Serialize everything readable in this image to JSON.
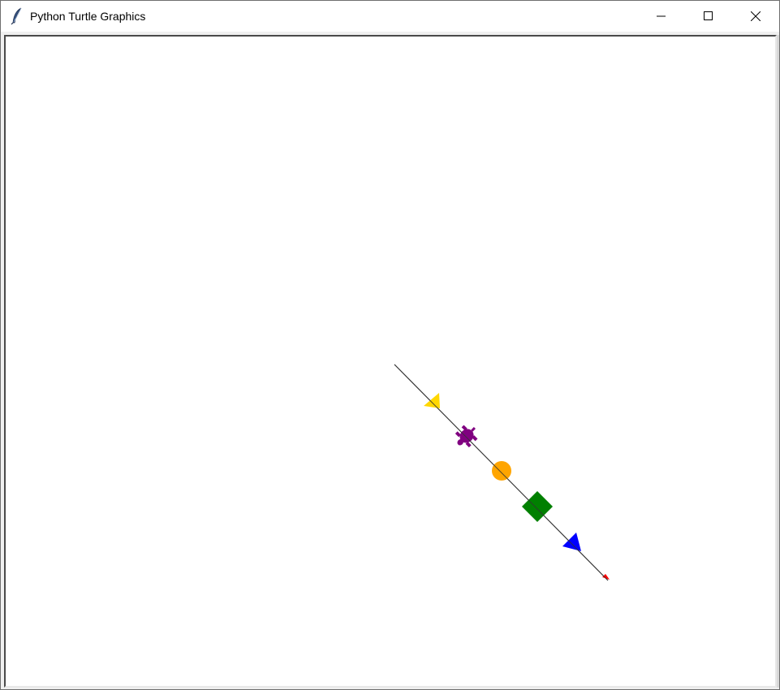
{
  "window": {
    "title": "Python Turtle Graphics",
    "app_icon": "feather-icon",
    "controls": {
      "minimize_icon": "minimize-icon",
      "maximize_icon": "maximize-icon",
      "close_icon": "close-icon"
    }
  },
  "canvas": {
    "background": "#ffffff",
    "line_color": "#333333",
    "turtles": [
      {
        "shape": "triangle",
        "color": "#ffd700",
        "name": "yellow-triangle-turtle"
      },
      {
        "shape": "turtle",
        "color": "#800080",
        "name": "purple-turtle-turtle"
      },
      {
        "shape": "circle",
        "color": "#ffa500",
        "name": "orange-circle-turtle"
      },
      {
        "shape": "square",
        "color": "#008000",
        "name": "green-square-turtle"
      },
      {
        "shape": "triangle",
        "color": "#0000ff",
        "name": "blue-triangle-turtle"
      },
      {
        "shape": "arrow",
        "color": "#ff0000",
        "name": "red-arrow-turtle"
      }
    ]
  }
}
